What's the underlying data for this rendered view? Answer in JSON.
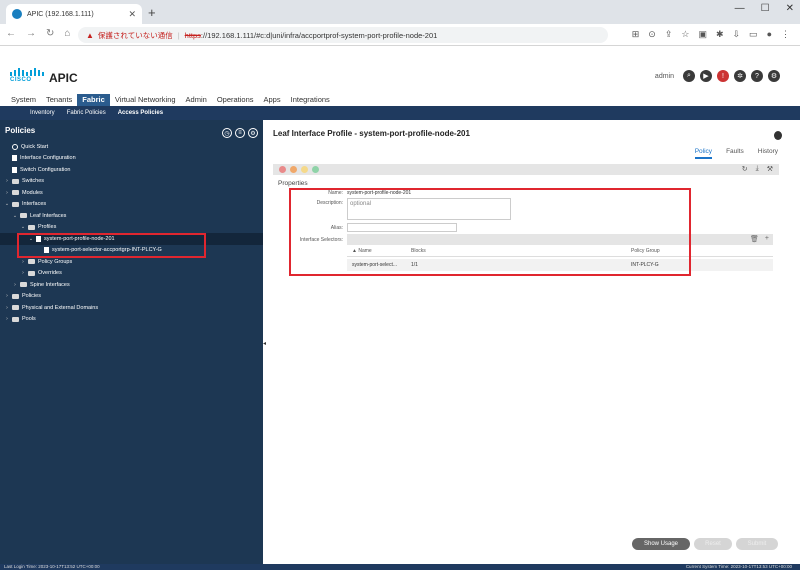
{
  "browser": {
    "tab_title": "APIC (192.168.1.111)",
    "tab_close": "✕",
    "new_tab": "+",
    "win_min": "—",
    "win_max": "☐",
    "win_close": "✕",
    "insecure_label": "保護されていない通信",
    "url_separator": "|",
    "url_scheme": "https",
    "url_rest": "://192.168.1.111/#c:d|uni/infra/accportprof-system-port-profile-node-201"
  },
  "apic": {
    "logo_text": "CISCO",
    "app_name": "APIC",
    "user": "admin",
    "main_tabs": [
      "System",
      "Tenants",
      "Fabric",
      "Virtual Networking",
      "Admin",
      "Operations",
      "Apps",
      "Integrations"
    ],
    "active_tab": "Fabric",
    "sub_tabs": [
      "Inventory",
      "Fabric Policies",
      "Access Policies"
    ],
    "active_sub_tab": "Access Policies"
  },
  "left_panel": {
    "title": "Policies",
    "tree": [
      {
        "label": "Quick Start",
        "depth": 0,
        "icon": "quick-start",
        "chev": ""
      },
      {
        "label": "Interface Configuration",
        "depth": 0,
        "icon": "doc",
        "chev": ""
      },
      {
        "label": "Switch Configuration",
        "depth": 0,
        "icon": "doc",
        "chev": ""
      },
      {
        "label": "Switches",
        "depth": 0,
        "icon": "folder",
        "chev": "›"
      },
      {
        "label": "Modules",
        "depth": 0,
        "icon": "folder",
        "chev": "›"
      },
      {
        "label": "Interfaces",
        "depth": 0,
        "icon": "folder",
        "chev": "⌄"
      },
      {
        "label": "Leaf Interfaces",
        "depth": 1,
        "icon": "folder",
        "chev": "⌄"
      },
      {
        "label": "Profiles",
        "depth": 2,
        "icon": "folder",
        "chev": "⌄"
      },
      {
        "label": "system-port-profile-node-201",
        "depth": 3,
        "icon": "doc",
        "chev": "⌄",
        "selected": true
      },
      {
        "label": "system-port-selector-accportgrp-INT-PLCY-G",
        "depth": 4,
        "icon": "doc",
        "chev": ""
      },
      {
        "label": "Policy Groups",
        "depth": 2,
        "icon": "folder",
        "chev": "›"
      },
      {
        "label": "Overrides",
        "depth": 2,
        "icon": "folder",
        "chev": "›"
      },
      {
        "label": "Spine Interfaces",
        "depth": 1,
        "icon": "folder",
        "chev": "›"
      },
      {
        "label": "Policies",
        "depth": 0,
        "icon": "folder",
        "chev": "›"
      },
      {
        "label": "Physical and External Domains",
        "depth": 0,
        "icon": "folder",
        "chev": "›"
      },
      {
        "label": "Pools",
        "depth": 0,
        "icon": "folder",
        "chev": "›"
      }
    ]
  },
  "right_panel": {
    "title": "Leaf Interface Profile - system-port-profile-node-201",
    "tabs": [
      "Policy",
      "Faults",
      "History"
    ],
    "active_tab": "Policy",
    "properties_label": "Properties",
    "name_label": "Name:",
    "name_value": "system-port-profile-node-201",
    "description_label": "Description:",
    "description_placeholder": "optional",
    "alias_label": "Alias:",
    "selectors_label": "Interface Selectors:",
    "grid_headers": [
      "▲ Name",
      "Blocks",
      "Policy Group"
    ],
    "grid_rows": [
      [
        "system-port-select...",
        "1/1",
        "INT-PLCY-G"
      ]
    ],
    "show_usage": "Show Usage",
    "reset": "Reset",
    "submit": "Submit"
  },
  "status": {
    "last_login": "Last Login Time: 2023-10-17T13:52 UTC+00:00",
    "system_time": "Current System Time: 2023-10-17T13:53 UTC+00:00"
  }
}
